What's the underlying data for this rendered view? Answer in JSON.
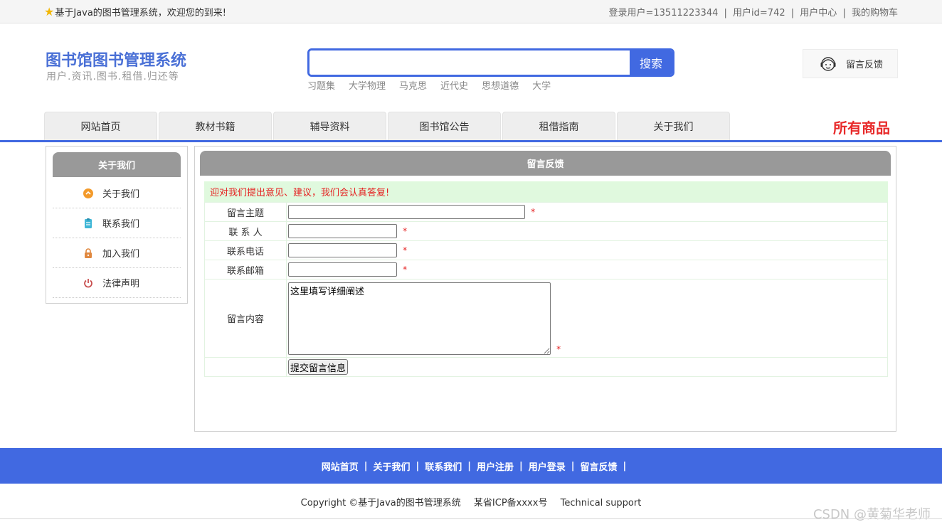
{
  "topbar": {
    "welcome": "基于Java的图书管理系统，欢迎您的到来!",
    "user_login": "登录用户=13511223344",
    "user_id": "用户id=742",
    "user_center": "用户中心",
    "cart": "我的购物车",
    "separator": "|"
  },
  "header": {
    "title": "图书馆图书管理系统",
    "subtitle": "用户.资讯.图书.租借.归还等",
    "search_placeholder": "",
    "search_button": "搜索",
    "hotwords": [
      "习题集",
      "大学物理",
      "马克思",
      "近代史",
      "思想道德",
      "大学"
    ],
    "feedback": "留言反馈"
  },
  "nav": {
    "tabs": [
      "网站首页",
      "教材书籍",
      "辅导资料",
      "图书馆公告",
      "租借指南",
      "关于我们"
    ],
    "all_goods": "所有商品"
  },
  "sidebar": {
    "title": "关于我们",
    "items": [
      {
        "label": "关于我们",
        "icon": "about-icon",
        "color": "#f39a2b"
      },
      {
        "label": "联系我们",
        "icon": "clipboard-icon",
        "color": "#3fb6d6"
      },
      {
        "label": "加入我们",
        "icon": "lock-icon",
        "color": "#e0883f"
      },
      {
        "label": "法律声明",
        "icon": "power-icon",
        "color": "#c84e4e"
      }
    ]
  },
  "main": {
    "title": "留言反馈",
    "notice": "迎对我们提出意见、建议，我们会认真答复!",
    "fields": {
      "subject_label": "留言主题",
      "contact_label": "联 系 人",
      "phone_label": "联系电话",
      "email_label": "联系邮箱",
      "content_label": "留言内容",
      "content_value": "这里填写详细阐述",
      "required_mark": "*"
    },
    "submit": "提交留言信息"
  },
  "footer": {
    "links": [
      "网站首页",
      "关于我们",
      "联系我们",
      "用户注册",
      "用户登录",
      "留言反馈"
    ],
    "separator": "|",
    "copyright": "Copyright ©基于Java的图书管理系统",
    "icp": "某省ICP备xxxx号",
    "support": "Technical support",
    "watermark": "CSDN @黄菊华老师"
  },
  "colors": {
    "brand_blue": "#4169e1",
    "title_blue": "#4a70d6",
    "red": "#e82a2a",
    "header_gray": "#999999",
    "notice_bg": "#e0f9de"
  }
}
